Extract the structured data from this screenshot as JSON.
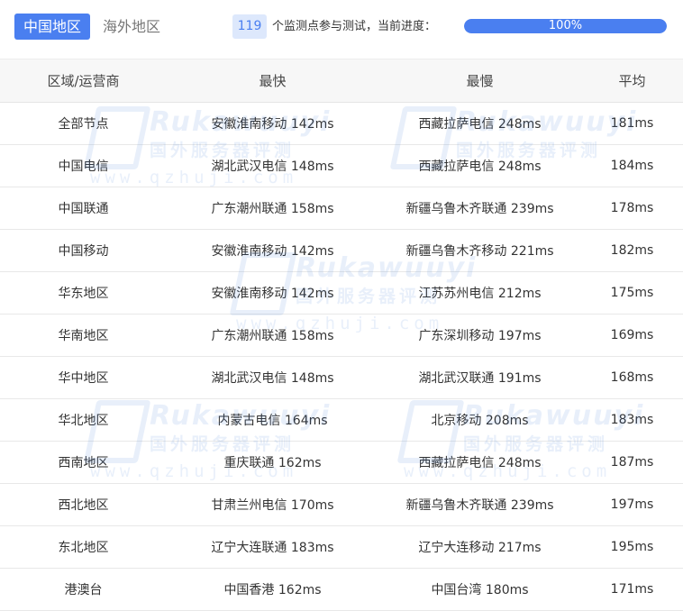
{
  "tabs": [
    {
      "label": "中国地区",
      "active": true
    },
    {
      "label": "海外地区",
      "active": false
    }
  ],
  "progress": {
    "count": "119",
    "text": "个监测点参与测试，当前进度：",
    "label": "100%",
    "value": 1.0
  },
  "table": {
    "headers": [
      "区域/运营商",
      "最快",
      "最慢",
      "平均"
    ],
    "rows": [
      {
        "region": "全部节点",
        "fastest": "安徽淮南移动 142ms",
        "slowest": "西藏拉萨电信 248ms",
        "average": "181ms"
      },
      {
        "region": "中国电信",
        "fastest": "湖北武汉电信 148ms",
        "slowest": "西藏拉萨电信 248ms",
        "average": "184ms"
      },
      {
        "region": "中国联通",
        "fastest": "广东潮州联通 158ms",
        "slowest": "新疆乌鲁木齐联通 239ms",
        "average": "178ms"
      },
      {
        "region": "中国移动",
        "fastest": "安徽淮南移动 142ms",
        "slowest": "新疆乌鲁木齐移动 221ms",
        "average": "182ms"
      },
      {
        "region": "华东地区",
        "fastest": "安徽淮南移动 142ms",
        "slowest": "江苏苏州电信 212ms",
        "average": "175ms"
      },
      {
        "region": "华南地区",
        "fastest": "广东潮州联通 158ms",
        "slowest": "广东深圳移动 197ms",
        "average": "169ms"
      },
      {
        "region": "华中地区",
        "fastest": "湖北武汉电信 148ms",
        "slowest": "湖北武汉联通 191ms",
        "average": "168ms"
      },
      {
        "region": "华北地区",
        "fastest": "内蒙古电信 164ms",
        "slowest": "北京移动 208ms",
        "average": "183ms"
      },
      {
        "region": "西南地区",
        "fastest": "重庆联通 162ms",
        "slowest": "西藏拉萨电信 248ms",
        "average": "187ms"
      },
      {
        "region": "西北地区",
        "fastest": "甘肃兰州电信 170ms",
        "slowest": "新疆乌鲁木齐联通 239ms",
        "average": "197ms"
      },
      {
        "region": "东北地区",
        "fastest": "辽宁大连联通 183ms",
        "slowest": "辽宁大连移动 217ms",
        "average": "195ms"
      },
      {
        "region": "港澳台",
        "fastest": "中国香港 162ms",
        "slowest": "中国台湾 180ms",
        "average": "171ms"
      }
    ]
  },
  "watermark": {
    "brand": "Rukawuuyi",
    "cn": "国外服务器评测",
    "url": "www.qzhuji.com"
  },
  "colors": {
    "accent": "#4a7ff0",
    "badge_bg": "#dde8fc",
    "header_bg": "#f7f7f7",
    "watermark": "#2a6fd6"
  }
}
